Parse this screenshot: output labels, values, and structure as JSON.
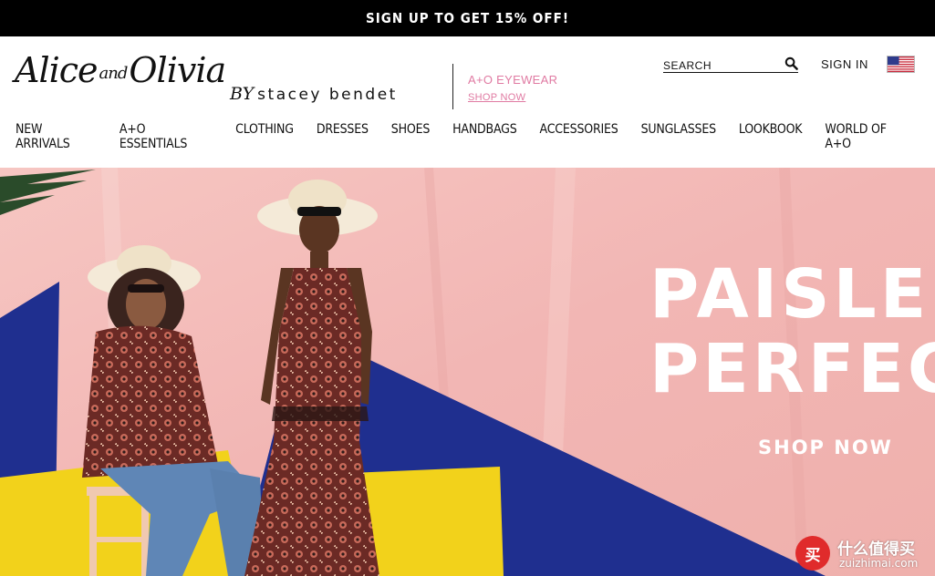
{
  "promo": {
    "text": "SIGN UP TO GET 15% OFF!"
  },
  "logo": {
    "alice": "Alice",
    "and": "and",
    "olivia": "Olivia",
    "by": "BY",
    "designer": "stacey bendet"
  },
  "eyewear": {
    "title": "A+O EYEWEAR",
    "link": "SHOP NOW"
  },
  "search": {
    "placeholder": "SEARCH",
    "icon": "search-icon"
  },
  "account": {
    "sign_in": "SIGN IN"
  },
  "locale": {
    "icon": "us-flag-icon"
  },
  "nav": {
    "items": [
      {
        "label": "NEW ARRIVALS"
      },
      {
        "label": "A+O ESSENTIALS"
      },
      {
        "label": "CLOTHING"
      },
      {
        "label": "DRESSES"
      },
      {
        "label": "SHOES"
      },
      {
        "label": "HANDBAGS"
      },
      {
        "label": "ACCESSORIES"
      },
      {
        "label": "SUNGLASSES"
      },
      {
        "label": "LOOKBOOK"
      },
      {
        "label": "WORLD OF A+O"
      }
    ]
  },
  "hero": {
    "title_line1": "PAISLE",
    "title_line2": "PERFEC",
    "cta": "SHOP NOW",
    "colors": {
      "background": "#f3bcbc",
      "blue": "#1f2f8f",
      "yellow": "#f2d21b"
    }
  },
  "watermark": {
    "badge": "买",
    "cn": "什么值得买",
    "en": "zuizhimai.com"
  },
  "colors": {
    "accent_pink": "#e07aa2",
    "promo_bg": "#000000"
  }
}
